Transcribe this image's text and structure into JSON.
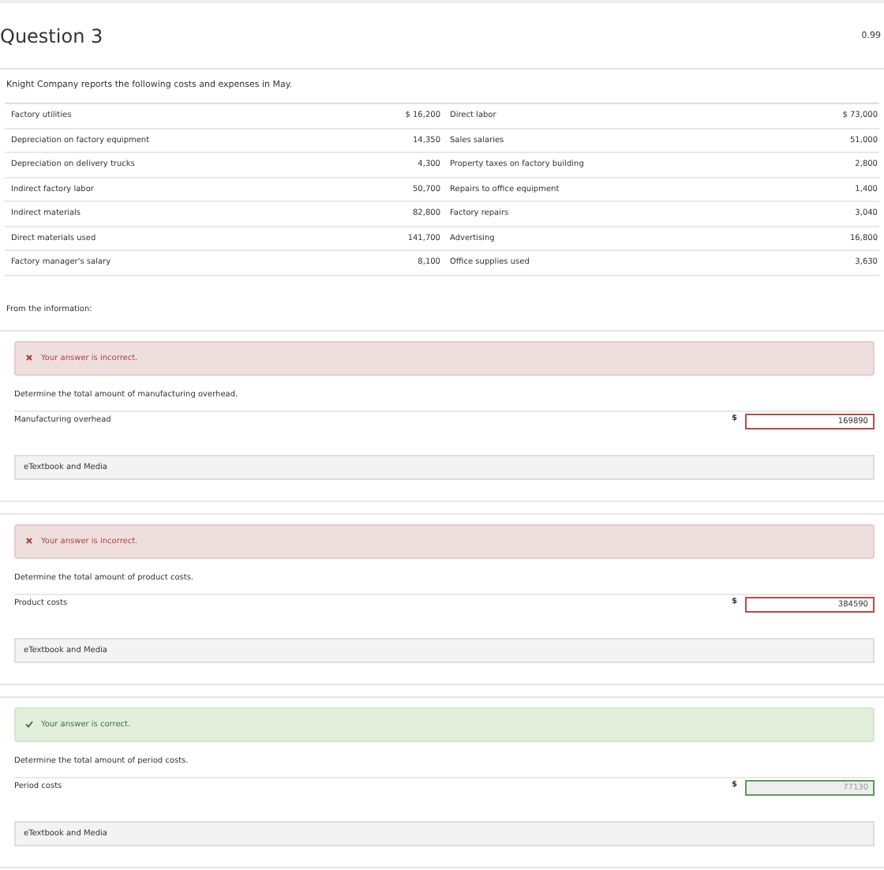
{
  "header": {
    "title": "Question 3",
    "score": "0.99"
  },
  "intro": "Knight Company reports the following costs and expenses in May.",
  "costs": [
    {
      "label": "Factory utilities",
      "amount": "$ 16,200",
      "label_2": "Direct labor",
      "amount_2": "$ 73,000"
    },
    {
      "label": "Depreciation on factory equipment",
      "amount": "14,350",
      "label_2": "Sales salaries",
      "amount_2": "51,000"
    },
    {
      "label": "Depreciation on delivery trucks",
      "amount": "4,300",
      "label_2": "Property taxes on factory building",
      "amount_2": "2,800"
    },
    {
      "label": "Indirect factory labor",
      "amount": "50,700",
      "label_2": "Repairs to office equipment",
      "amount_2": "1,400"
    },
    {
      "label": "Indirect materials",
      "amount": "82,800",
      "label_2": "Factory repairs",
      "amount_2": "3,040"
    },
    {
      "label": "Direct materials used",
      "amount": "141,700",
      "label_2": "Advertising",
      "amount_2": "16,800"
    },
    {
      "label": "Factory manager's salary",
      "amount": "8,100",
      "label_2": "Office supplies used",
      "amount_2": "3,630"
    }
  ],
  "lead": "From the information:",
  "parts": [
    {
      "correct": false,
      "feedback": "Your answer is incorrect.",
      "question": "Determine the total amount of manufacturing overhead.",
      "label": "Manufacturing overhead",
      "currency": "$",
      "value": "169890",
      "disabled": false,
      "link": "eTextbook and Media"
    },
    {
      "correct": false,
      "feedback": "Your answer is incorrect.",
      "question": "Determine the total amount of product costs.",
      "label": "Product costs",
      "currency": "$",
      "value": "384590",
      "disabled": false,
      "link": "eTextbook and Media"
    },
    {
      "correct": true,
      "feedback": "Your answer is correct.",
      "question": "Determine the total amount of period costs.",
      "label": "Period costs",
      "currency": "$",
      "value": "77130",
      "disabled": true,
      "link": "eTextbook and Media"
    }
  ]
}
